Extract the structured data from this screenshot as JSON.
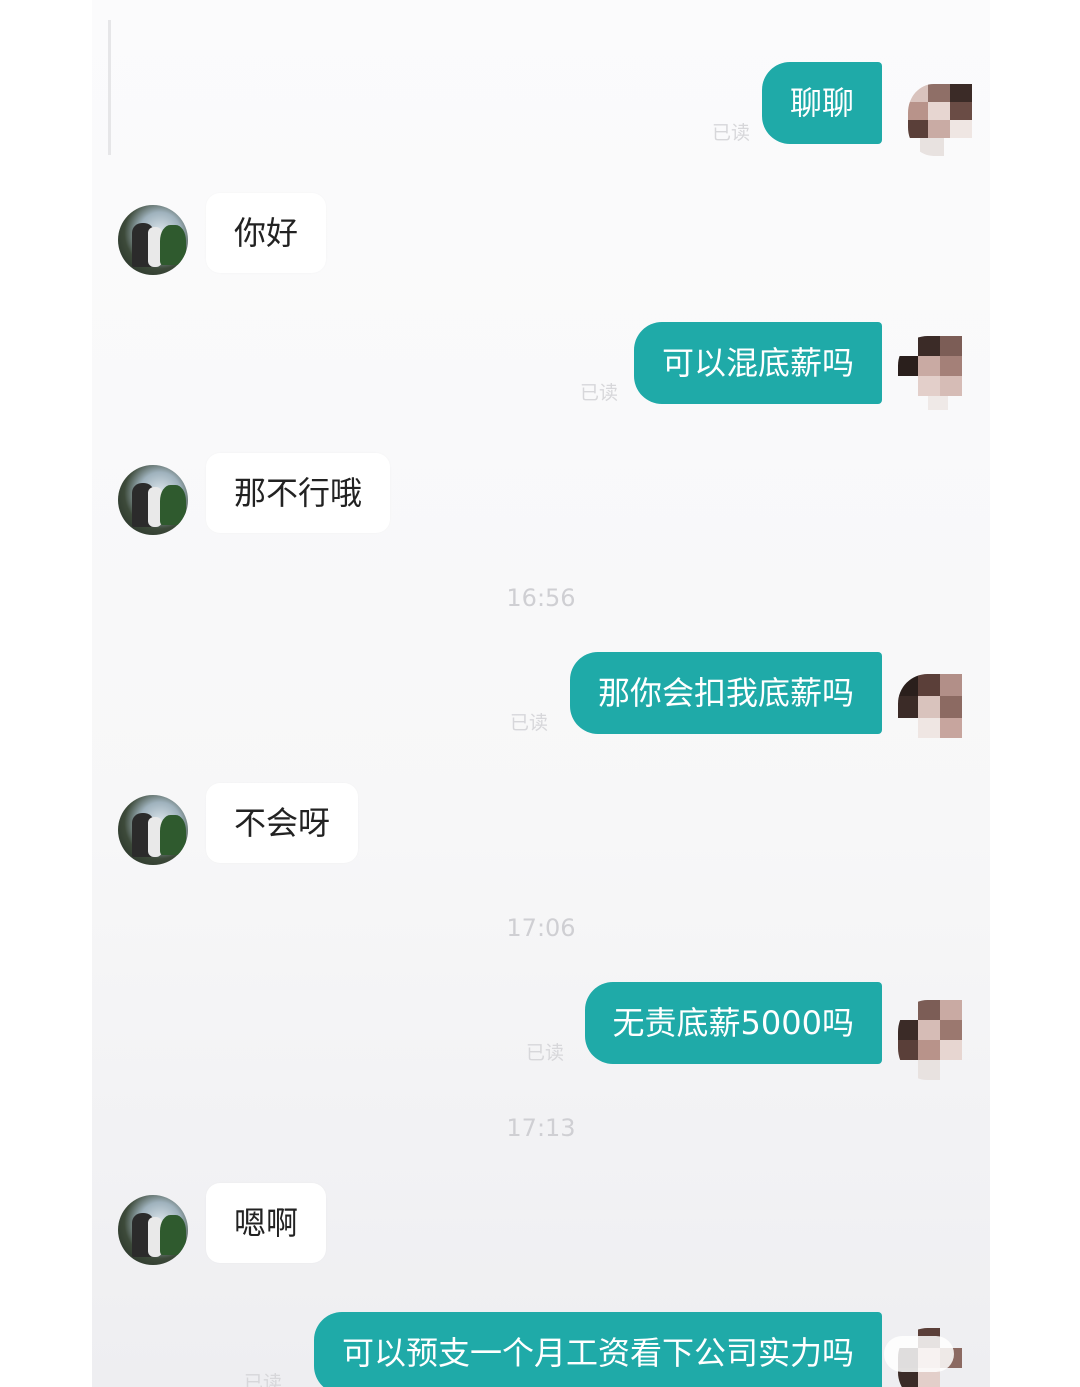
{
  "chat": {
    "messages": [
      {
        "side": "out",
        "text": "聊聊",
        "status": "已读"
      },
      {
        "side": "in",
        "text": "你好"
      },
      {
        "side": "out",
        "text": "可以混底薪吗",
        "status": "已读"
      },
      {
        "side": "in",
        "text": "那不行哦"
      },
      {
        "side": "time",
        "text": "16:56"
      },
      {
        "side": "out",
        "text": "那你会扣我底薪吗",
        "status": "已读"
      },
      {
        "side": "in",
        "text": "不会呀"
      },
      {
        "side": "time",
        "text": "17:06"
      },
      {
        "side": "out",
        "text": "无责底薪5000吗",
        "status": "已读"
      },
      {
        "side": "time",
        "text": "17:13"
      },
      {
        "side": "in",
        "text": "嗯啊"
      },
      {
        "side": "out",
        "text": "可以预支一个月工资看下公司实力吗",
        "status": "已读"
      }
    ]
  },
  "colors": {
    "outgoing_bubble": "#1faaa8",
    "incoming_bubble": "#ffffff",
    "background": "#f7f7f8"
  }
}
